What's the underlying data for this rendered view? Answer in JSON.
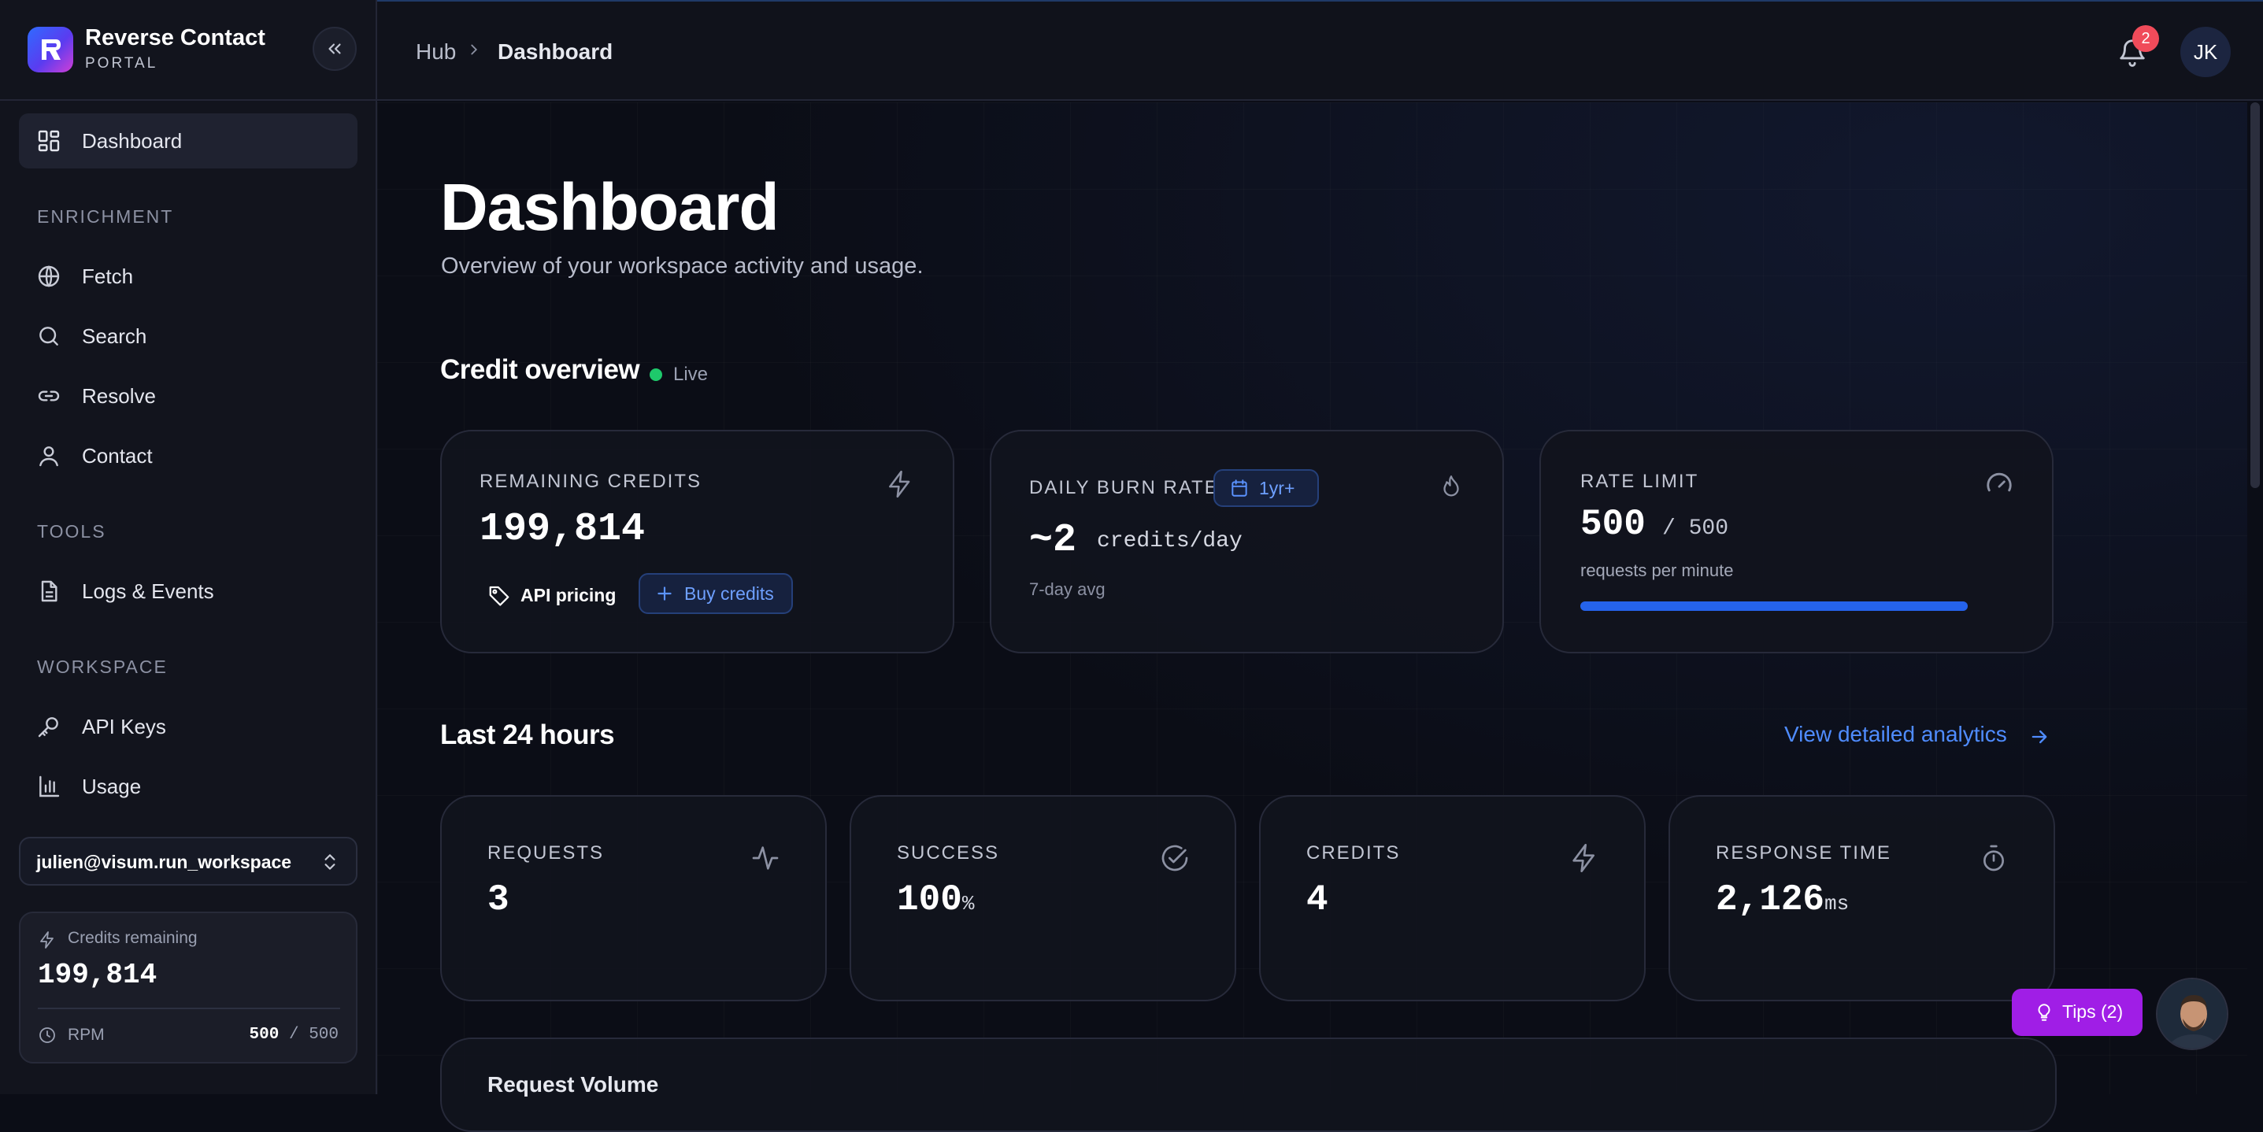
{
  "brand": {
    "title": "Reverse Contact",
    "subtitle": "PORTAL"
  },
  "sidebar": {
    "items": [
      {
        "label": "Dashboard",
        "icon": "grid-icon",
        "active": true
      },
      {
        "label": "Fetch",
        "icon": "globe-icon"
      },
      {
        "label": "Search",
        "icon": "search-icon"
      },
      {
        "label": "Resolve",
        "icon": "link-icon"
      },
      {
        "label": "Contact",
        "icon": "user-icon"
      },
      {
        "label": "Logs & Events",
        "icon": "document-icon"
      },
      {
        "label": "API Keys",
        "icon": "key-icon"
      },
      {
        "label": "Usage",
        "icon": "bar-chart-icon"
      }
    ],
    "sections": {
      "enrichment": "ENRICHMENT",
      "tools": "TOOLS",
      "workspace": "WORKSPACE"
    },
    "workspace_name": "julien@visum.run_workspace",
    "credits": {
      "label": "Credits remaining",
      "value": "199,814",
      "rpm_label": "RPM",
      "rpm_used": "500",
      "rpm_sep": "/",
      "rpm_total": "500"
    }
  },
  "topbar": {
    "breadcrumb": [
      "Hub",
      "Dashboard"
    ],
    "notification_count": "2",
    "avatar_initials": "JK"
  },
  "page": {
    "title": "Dashboard",
    "subtitle": "Overview of your workspace activity and usage."
  },
  "credit_overview": {
    "title": "Credit overview",
    "live_label": "Live",
    "remaining": {
      "label": "REMAINING CREDITS",
      "value": "199,814",
      "api_pricing_label": "API pricing",
      "buy_credits_label": "Buy credits"
    },
    "burn_rate": {
      "label": "DAILY BURN RATE",
      "period": "1yr+",
      "value": "~2",
      "unit": "credits/day",
      "note": "7-day avg"
    },
    "rate_limit": {
      "label": "RATE LIMIT",
      "used": "500",
      "sep": "/",
      "total": "500",
      "note": "requests per minute",
      "fill_fraction": 1.0
    }
  },
  "last_24h": {
    "title": "Last 24 hours",
    "analytics_link": "View detailed analytics",
    "stats": [
      {
        "label": "REQUESTS",
        "value": "3",
        "unit": "",
        "icon": "activity-icon"
      },
      {
        "label": "SUCCESS",
        "value": "100",
        "unit": "%",
        "icon": "check-circle-icon"
      },
      {
        "label": "CREDITS",
        "value": "4",
        "unit": "",
        "icon": "bolt-icon"
      },
      {
        "label": "RESPONSE TIME",
        "value": "2,126",
        "unit": "ms",
        "icon": "stopwatch-icon"
      }
    ]
  },
  "request_volume": {
    "title": "Request Volume"
  },
  "tips": {
    "label": "Tips (2)"
  },
  "colors": {
    "accent": "#2563eb",
    "link": "#4f8cff",
    "live": "#1ec96b",
    "tips": "#a01ee6",
    "badge": "#f04b5a"
  }
}
